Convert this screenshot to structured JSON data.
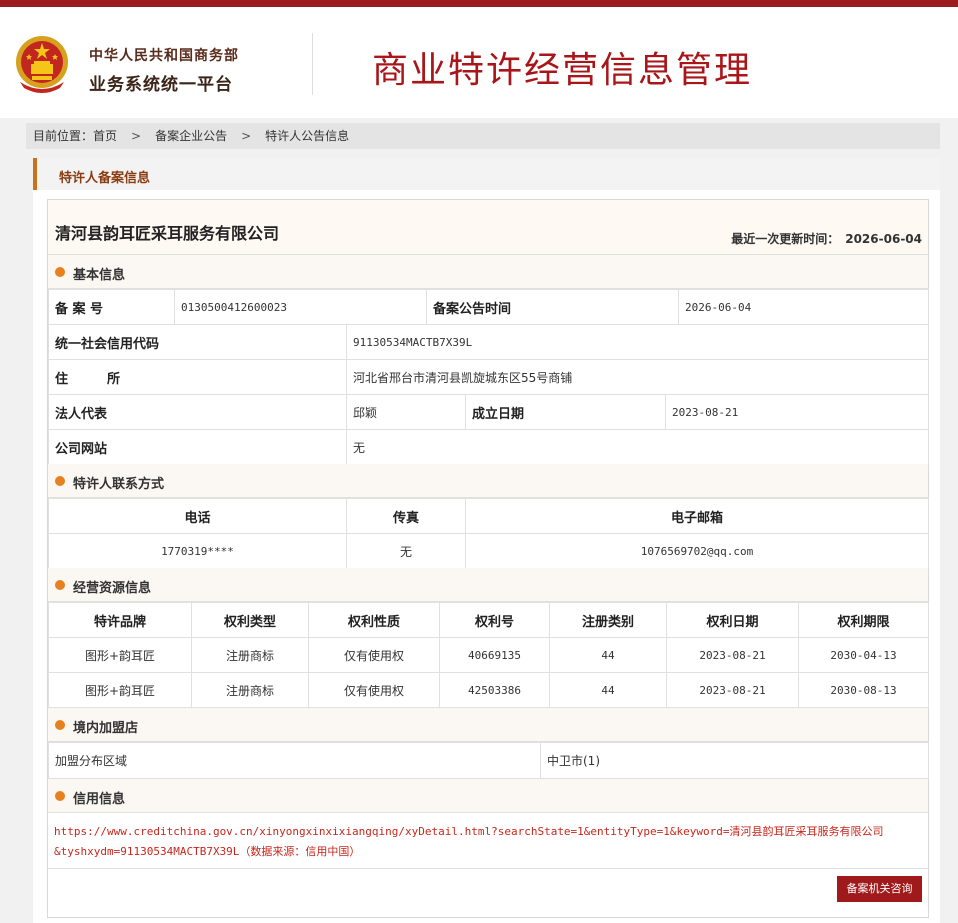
{
  "header": {
    "org_line1": "中华人民共和国商务部",
    "org_line2": "业务系统统一平台",
    "title": "商业特许经营信息管理"
  },
  "breadcrumb": {
    "prefix": "目前位置：",
    "items": [
      "首页",
      "备案企业公告",
      "特许人公告信息"
    ],
    "separator": ">"
  },
  "panel": {
    "title": "特许人备案信息"
  },
  "company": {
    "name": "清河县韵耳匠采耳服务有限公司",
    "updated_label": "最近一次更新时间：",
    "updated_value": "2026-06-04"
  },
  "basic": {
    "section_title": "基本信息",
    "record_no_label": "备 案 号",
    "record_no": "0130500412600023",
    "notice_time_label": "备案公告时间",
    "notice_time": "2026-06-04",
    "credit_code_label": "统一社会信用代码",
    "credit_code": "91130534MACTB7X39L",
    "address_label": "住　　　所",
    "address": "河北省邢台市清河县凯旋城东区55号商铺",
    "legal_rep_label": "法人代表",
    "legal_rep": "邱颖",
    "founded_label": "成立日期",
    "founded": "2023-08-21",
    "website_label": "公司网站",
    "website": "无"
  },
  "contact": {
    "section_title": "特许人联系方式",
    "headers": [
      "电话",
      "传真",
      "电子邮箱"
    ],
    "phone": "1770319****",
    "fax": "无",
    "email": "1076569702@qq.com"
  },
  "resources": {
    "section_title": "经营资源信息",
    "headers": [
      "特许品牌",
      "权利类型",
      "权利性质",
      "权利号",
      "注册类别",
      "权利日期",
      "权利期限"
    ],
    "rows": [
      [
        "图形+韵耳匠",
        "注册商标",
        "仅有使用权",
        "40669135",
        "44",
        "2023-08-21",
        "2030-04-13"
      ],
      [
        "图形+韵耳匠",
        "注册商标",
        "仅有使用权",
        "42503386",
        "44",
        "2023-08-21",
        "2030-08-13"
      ]
    ]
  },
  "stores": {
    "section_title": "境内加盟店",
    "label": "加盟分布区域",
    "value": "中卫市(1)"
  },
  "credit": {
    "section_title": "信用信息",
    "url_part1": "https://www.creditchina.gov.cn/xinyongxinxixiangqing/xyDetail.html?searchState=1&entityType=1&keyword=",
    "url_company": "清河县韵耳匠采耳服务有限公司",
    "url_part2": "&tyshxydm=91130534MACTB7X39L",
    "source": "（数据来源：信用中国）"
  },
  "button": {
    "label": "备案机关咨询"
  },
  "colors": {
    "brand_red": "#9b1b1e",
    "title_red": "#a8161a",
    "accent_orange": "#e8801e",
    "link_red": "#c9261c"
  }
}
